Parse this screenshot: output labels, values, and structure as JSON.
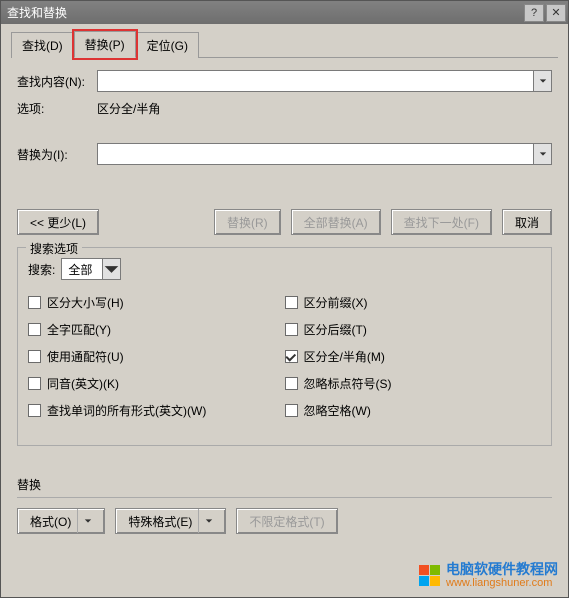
{
  "window": {
    "title": "查找和替换"
  },
  "tabs": {
    "find": "查找(D)",
    "replace": "替换(P)",
    "goto": "定位(G)"
  },
  "form": {
    "find_label": "查找内容(N):",
    "find_value": "",
    "options_label": "选项:",
    "options_value": "区分全/半角",
    "replace_label": "替换为(I):",
    "replace_value": ""
  },
  "buttons": {
    "less": "<< 更少(L)",
    "replace_one": "替换(R)",
    "replace_all": "全部替换(A)",
    "find_next": "查找下一处(F)",
    "cancel": "取消"
  },
  "search_options": {
    "legend": "搜索选项",
    "search_label": "搜索:",
    "search_selected": "全部",
    "left": [
      {
        "label": "区分大小写(H)",
        "checked": false
      },
      {
        "label": "全字匹配(Y)",
        "checked": false
      },
      {
        "label": "使用通配符(U)",
        "checked": false
      },
      {
        "label": "同音(英文)(K)",
        "checked": false
      },
      {
        "label": "查找单词的所有形式(英文)(W)",
        "checked": false
      }
    ],
    "right": [
      {
        "label": "区分前缀(X)",
        "checked": false
      },
      {
        "label": "区分后缀(T)",
        "checked": false
      },
      {
        "label": "区分全/半角(M)",
        "checked": true
      },
      {
        "label": "忽略标点符号(S)",
        "checked": false
      },
      {
        "label": "忽略空格(W)",
        "checked": false
      }
    ]
  },
  "replace_section": {
    "legend": "替换",
    "format": "格式(O)",
    "special_format": "特殊格式(E)",
    "no_format": "不限定格式(T)"
  },
  "watermark": {
    "line1": "电脑软硬件教程网",
    "line2": "www.liangshuner.com"
  }
}
